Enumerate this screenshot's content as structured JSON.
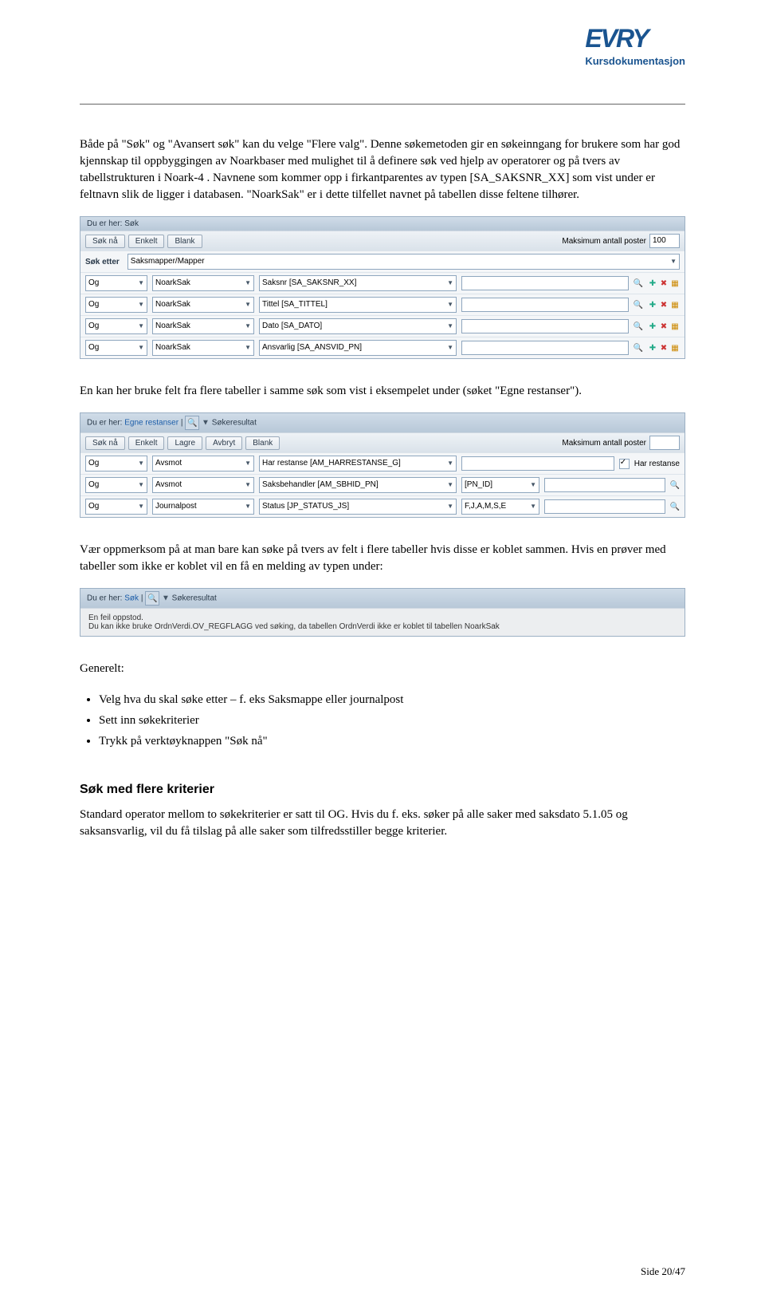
{
  "header": {
    "logo": "EVRY",
    "tagline": "Kursdokumentasjon"
  },
  "para1": "Både på \"Søk\" og \"Avansert søk\" kan du velge \"Flere valg\". Denne søkemetoden gir en søkeinngang for brukere som har god kjennskap til oppbyggingen av Noarkbaser med mulighet til å definere søk ved hjelp av operatorer og på tvers av tabellstrukturen i Noark-4 . Navnene som kommer opp i firkantparentes av typen [SA_SAKSNR_XX] som vist under er feltnavn slik de ligger i databasen. \"NoarkSak\" er i dette tilfellet navnet på tabellen disse feltene tilhører.",
  "app1": {
    "breadcrumb": "Du er her: Søk",
    "btns": [
      "Søk nå",
      "Enkelt",
      "Blank"
    ],
    "max_label": "Maksimum antall poster",
    "max_val": "100",
    "sok_etter": "Søk etter",
    "sok_table": "Saksmapper/Mapper",
    "rows": [
      {
        "op": "Og",
        "tbl": "NoarkSak",
        "field": "Saksnr [SA_SAKSNR_XX]",
        "val": ""
      },
      {
        "op": "Og",
        "tbl": "NoarkSak",
        "field": "Tittel [SA_TITTEL]",
        "val": ""
      },
      {
        "op": "Og",
        "tbl": "NoarkSak",
        "field": "Dato [SA_DATO]",
        "val": ""
      },
      {
        "op": "Og",
        "tbl": "NoarkSak",
        "field": "Ansvarlig [SA_ANSVID_PN]",
        "val": ""
      }
    ]
  },
  "para2": "En kan her bruke felt fra flere tabeller i samme søk som vist i eksempelet under (søket \"Egne restanser\").",
  "app2": {
    "bc_prefix": "Du er her:",
    "bc_link": "Egne restanser",
    "bc_tail": "Søkeresultat",
    "btns": [
      "Søk nå",
      "Enkelt",
      "Lagre",
      "Avbryt",
      "Blank"
    ],
    "max_label": "Maksimum antall poster",
    "rows": [
      {
        "op": "Og",
        "tbl": "Avsmot",
        "field": "Har restanse [AM_HARRESTANSE_G]",
        "chk": "Har restanse"
      },
      {
        "op": "Og",
        "tbl": "Avsmot",
        "field": "Saksbehandler [AM_SBHID_PN]",
        "val": "[PN_ID]"
      },
      {
        "op": "Og",
        "tbl": "Journalpost",
        "field": "Status [JP_STATUS_JS]",
        "val": "F,J,A,M,S,E"
      }
    ]
  },
  "para3": "Vær oppmerksom på at man bare kan søke på tvers av felt i flere tabeller hvis disse er koblet sammen. Hvis en prøver med tabeller som ikke er koblet vil en få en melding av typen under:",
  "app3": {
    "bc_prefix": "Du er her:",
    "bc_link": "Søk",
    "bc_tail": "Søkeresultat",
    "err1": "En feil oppstod.",
    "err2": "Du kan ikke bruke OrdnVerdi.OV_REGFLAGG ved søking, da tabellen OrdnVerdi ikke er koblet til tabellen NoarkSak"
  },
  "generelt": "Generelt:",
  "bullets": [
    "Velg hva du skal søke etter – f. eks Saksmappe eller journalpost",
    "Sett inn søkekriterier",
    "Trykk på verktøyknappen \"Søk nå\""
  ],
  "h3": "Søk med flere kriterier",
  "para4": "Standard operator mellom to søkekriterier er satt til OG. Hvis du f. eks. søker på alle saker med saksdato 5.1.05 og saksansvarlig, vil du få tilslag på alle saker som tilfredsstiller begge kriterier.",
  "footer": "Side 20/47"
}
